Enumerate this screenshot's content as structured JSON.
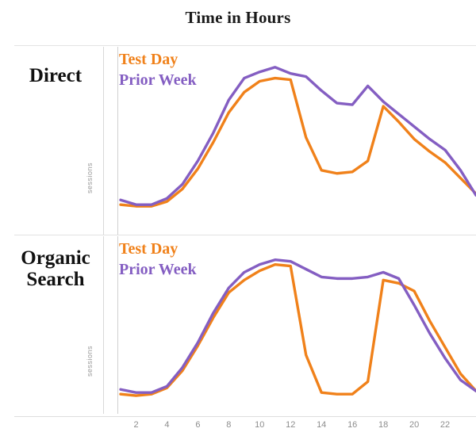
{
  "title": "Time in Hours",
  "colors": {
    "test_day": "#F0811A",
    "prior_week": "#845EC2",
    "rule": "#e3e3e3",
    "axis_text": "#8d8d8d",
    "label_text": "#111111"
  },
  "legend": {
    "test_day_label": "Test Day",
    "prior_week_label": "Prior Week"
  },
  "panels": [
    {
      "row_label": "Direct",
      "y_axis_label": "sessions"
    },
    {
      "row_label_line1": "Organic",
      "row_label_line2": "Search",
      "y_axis_label": "sessions"
    }
  ],
  "x_ticks": [
    "2",
    "4",
    "6",
    "8",
    "10",
    "12",
    "14",
    "16",
    "18",
    "20",
    "22"
  ],
  "chart_data": {
    "type": "line",
    "title": "Time in Hours",
    "xlabel": "Time in Hours",
    "ylabel": "sessions",
    "grid": false,
    "legend_position": "top-left-inside",
    "x": [
      1,
      2,
      3,
      4,
      5,
      6,
      7,
      8,
      9,
      10,
      11,
      12,
      13,
      14,
      15,
      16,
      17,
      18,
      19,
      20,
      21,
      22,
      23,
      24
    ],
    "xlim": [
      1,
      24
    ],
    "ylim": [
      0,
      100
    ],
    "x_tick_labels": [
      "2",
      "4",
      "6",
      "8",
      "10",
      "12",
      "14",
      "16",
      "18",
      "20",
      "22"
    ],
    "panels": [
      {
        "name": "Direct",
        "ylabel": "sessions",
        "series": [
          {
            "name": "Test Day",
            "color": "#F0811A",
            "values": [
              5,
              4,
              4,
              7,
              15,
              28,
              45,
              64,
              77,
              84,
              86,
              85,
              48,
              27,
              25,
              26,
              33,
              68,
              58,
              47,
              39,
              32,
              22,
              12
            ]
          },
          {
            "name": "Prior Week",
            "color": "#845EC2",
            "values": [
              8,
              5,
              5,
              9,
              18,
              33,
              51,
              72,
              86,
              90,
              93,
              89,
              87,
              78,
              70,
              69,
              81,
              71,
              63,
              55,
              47,
              40,
              27,
              11
            ]
          }
        ]
      },
      {
        "name": "Organic Search",
        "ylabel": "sessions",
        "series": [
          {
            "name": "Test Day",
            "color": "#F0811A",
            "values": [
              5,
              4,
              5,
              9,
              20,
              36,
              54,
              70,
              78,
              84,
              88,
              87,
              30,
              6,
              5,
              5,
              13,
              78,
              76,
              71,
              52,
              35,
              18,
              7
            ]
          },
          {
            "name": "Prior Week",
            "color": "#845EC2",
            "values": [
              8,
              6,
              6,
              10,
              22,
              38,
              57,
              73,
              83,
              88,
              91,
              90,
              85,
              80,
              79,
              79,
              80,
              83,
              79,
              62,
              44,
              28,
              14,
              7
            ]
          }
        ]
      }
    ]
  }
}
